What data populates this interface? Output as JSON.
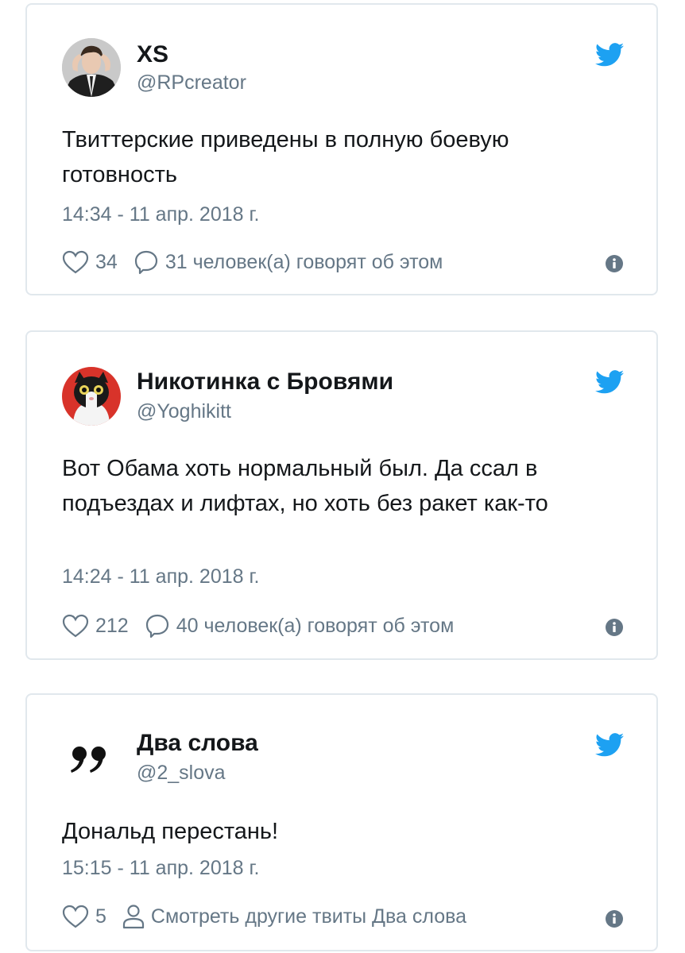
{
  "tweets": [
    {
      "display_name": "XS",
      "handle": "@RPcreator",
      "text": "Твиттерские приведены в полную боевую готовность",
      "timestamp": "14:34 - 11 апр. 2018 г.",
      "likes": "34",
      "activity": "31 человек(а) говорят об этом",
      "avatar_icon": "person-photo-avatar",
      "activity_icon": "speech-bubble-icon"
    },
    {
      "display_name": "Никотинка с Бровями",
      "handle": "@Yoghikitt",
      "text": "Вот Обама хоть нормальный был. Да ссал в подъездах и лифтах, но хоть без ракет как-то",
      "timestamp": "14:24 - 11 апр. 2018 г.",
      "likes": "212",
      "activity": "40 человек(а) говорят об этом",
      "avatar_icon": "cat-avatar",
      "activity_icon": "speech-bubble-icon"
    },
    {
      "display_name": "Два слова",
      "handle": "@2_slova",
      "text": "Дональд перестань!",
      "timestamp": "15:15 - 11 апр. 2018 г.",
      "likes": "5",
      "activity": "Смотреть другие твиты Два слова",
      "avatar_icon": "quote-marks-avatar",
      "activity_icon": "person-icon"
    }
  ],
  "colors": {
    "brand_blue": "#1da1f2",
    "text_primary": "#14171a",
    "text_secondary": "#657786",
    "card_border": "#e1e8ed"
  }
}
